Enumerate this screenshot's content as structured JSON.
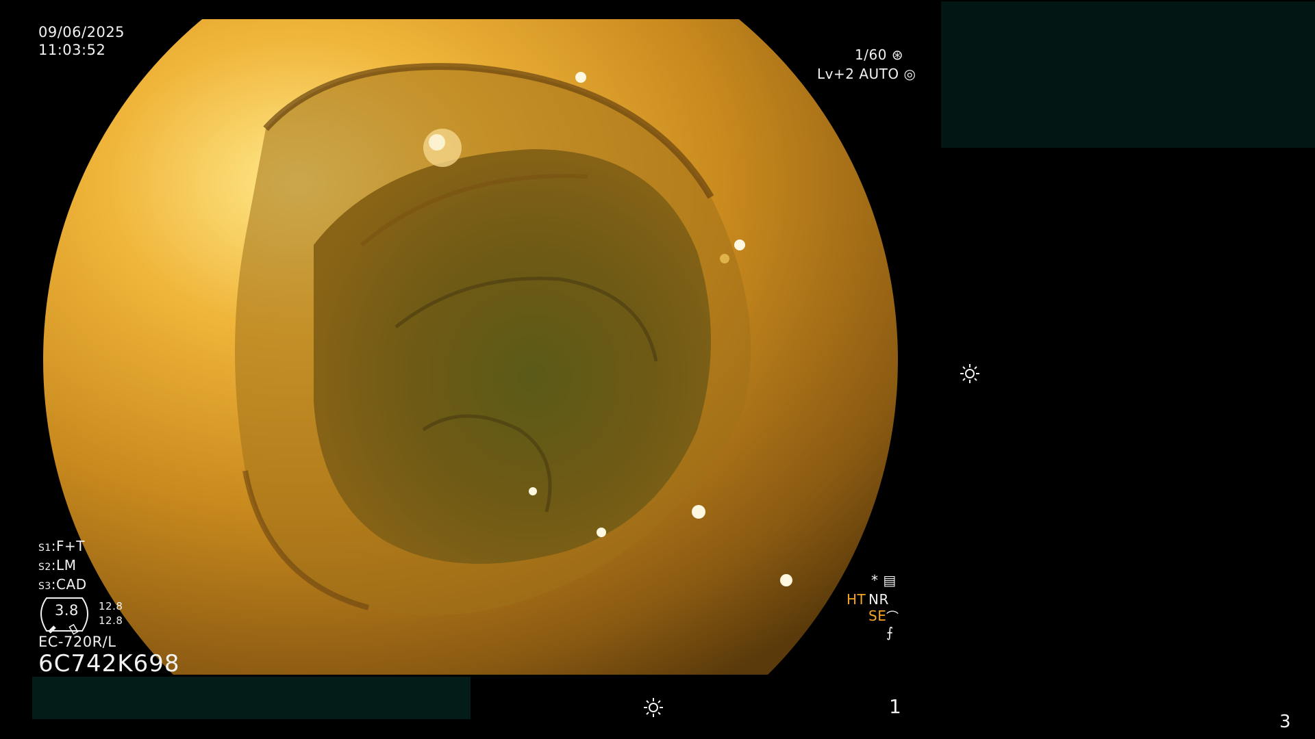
{
  "overlay": {
    "date": "09/06/2025",
    "time": "11:03:52",
    "shutter": "1/60",
    "level": "Lv+2 AUTO",
    "settings": [
      {
        "key": "S1",
        "value": "F+T"
      },
      {
        "key": "S2",
        "value": "LM"
      },
      {
        "key": "S3",
        "value": "CAD"
      }
    ],
    "gauge_value": "3.8",
    "gauge_side_top": "12.8",
    "gauge_side_bottom": "12.8",
    "model": "EC-720R/L",
    "serial": "6C742K698",
    "star": "*",
    "ht": "HT",
    "nr": "NR",
    "se": "SE",
    "bottom_number": "1",
    "corner_number": "3"
  },
  "colors": {
    "ht_accent": "#f5a623",
    "redaction": "#031c17"
  },
  "icons": {
    "shutter": "aperture-icon",
    "auto": "iris-icon",
    "menu": "menu-icon",
    "sun": "sun-icon",
    "se": "se-icon",
    "f": "freeze-icon"
  }
}
